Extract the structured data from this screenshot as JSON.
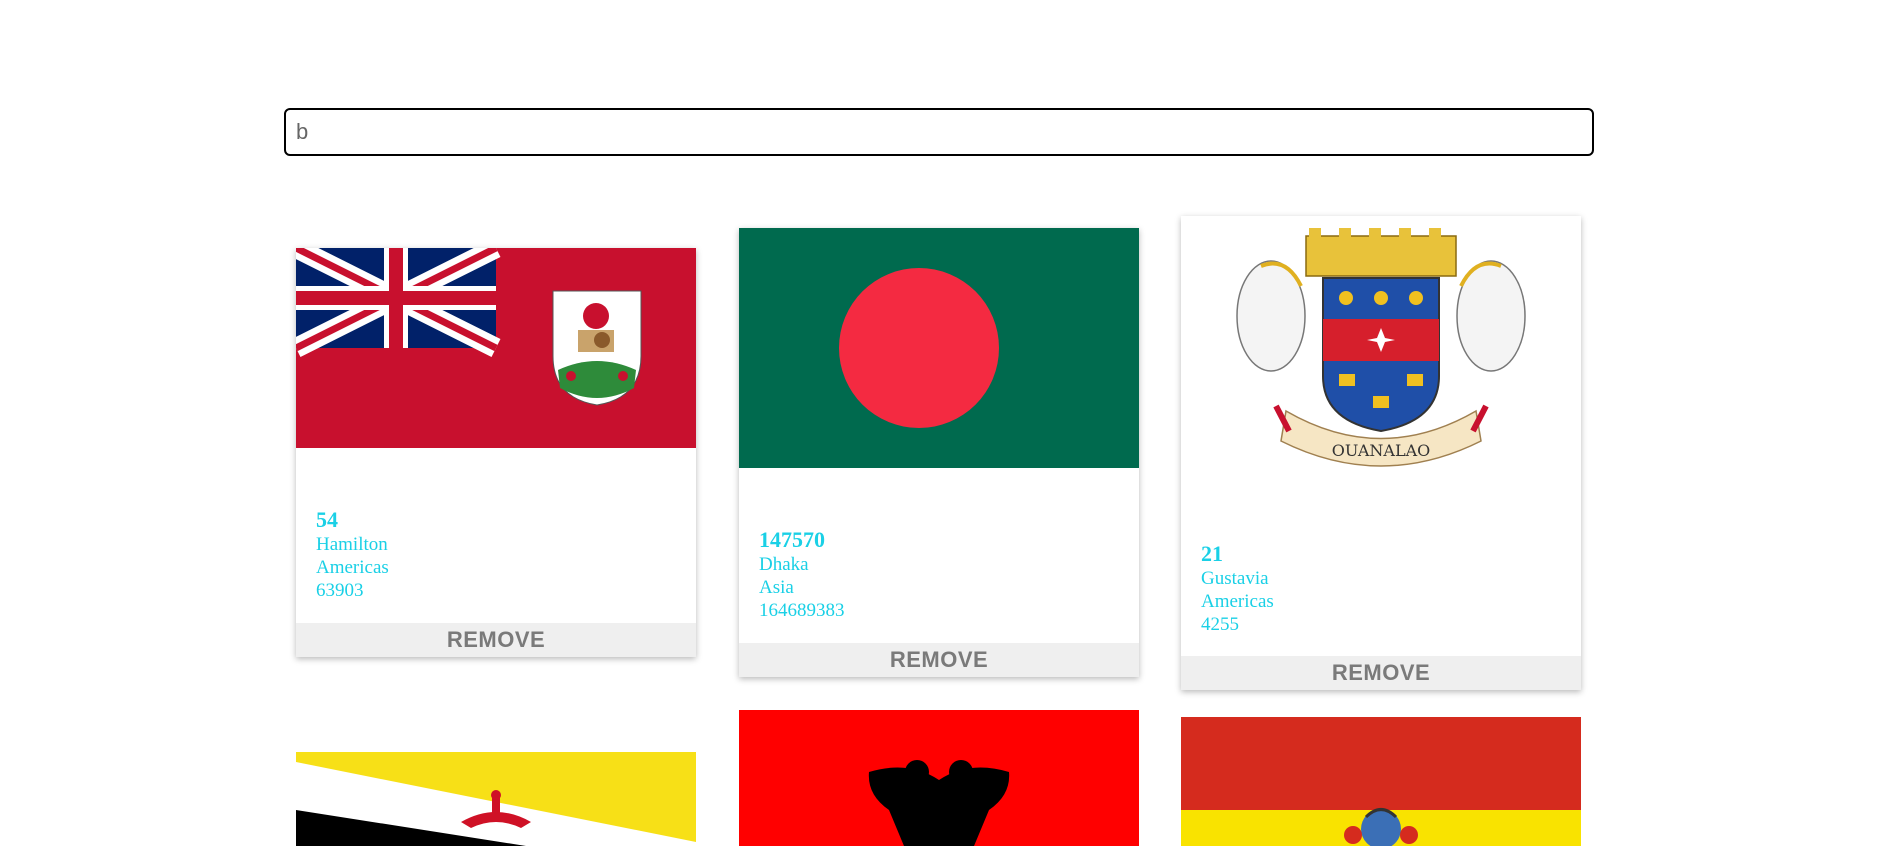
{
  "search": {
    "value": "b"
  },
  "cards": [
    {
      "num": "54",
      "capital": "Hamilton",
      "region": "Americas",
      "population": "63903",
      "remove_label": "REMOVE",
      "flag": "bermuda-flag"
    },
    {
      "num": "147570",
      "capital": "Dhaka",
      "region": "Asia",
      "population": "164689383",
      "remove_label": "REMOVE",
      "flag": "bangladesh-flag"
    },
    {
      "num": "21",
      "capital": "Gustavia",
      "region": "Americas",
      "population": "4255",
      "remove_label": "REMOVE",
      "flag": "saint-barthelemy-coat-of-arms",
      "flag_motto": "OUANALAO"
    },
    {
      "flag": "brunei-flag"
    },
    {
      "flag": "albania-flag"
    },
    {
      "flag": "bolivia-flag"
    }
  ],
  "colors": {
    "info_text": "#1ad0e6",
    "remove_bg": "#efefef",
    "remove_text": "#7a7a7a"
  }
}
